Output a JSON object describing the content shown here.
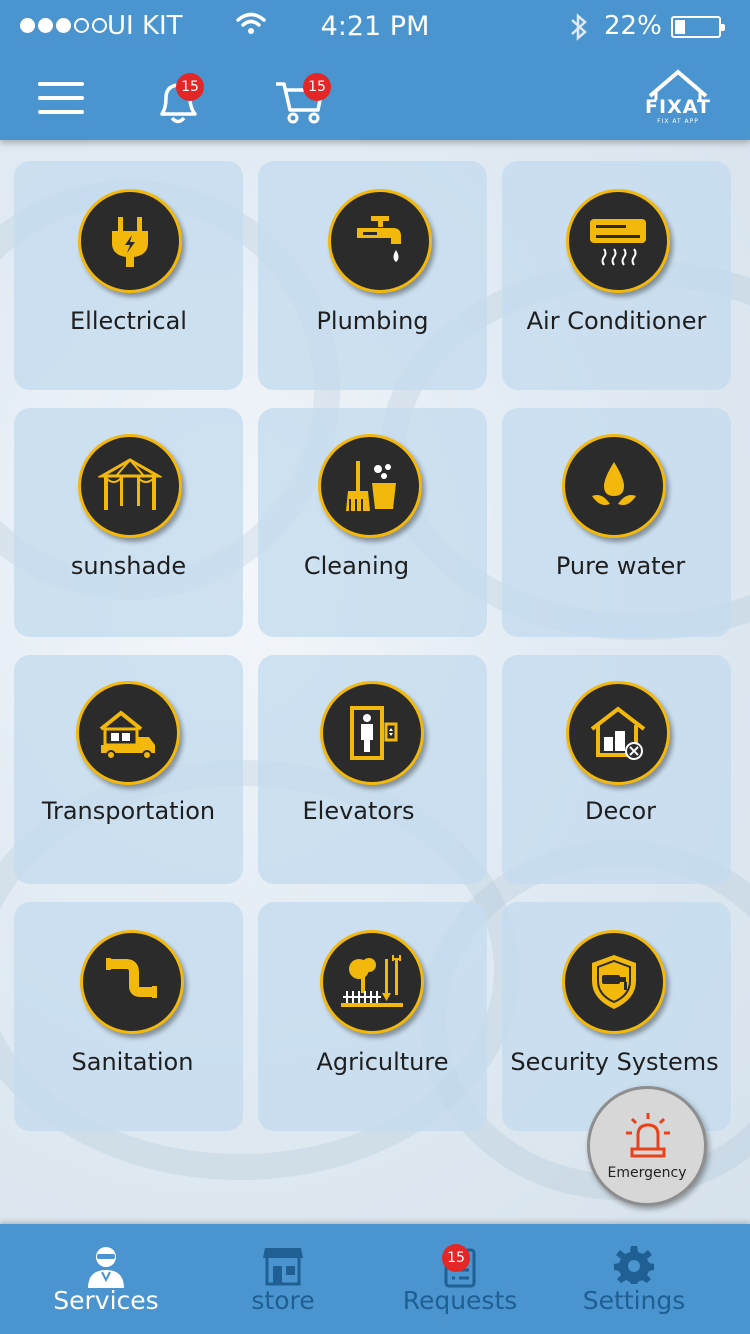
{
  "status_bar": {
    "carrier": "UI KIT",
    "time": "4:21 PM",
    "battery": "22%",
    "battery_level": 0.22,
    "signal_dots": 5,
    "signal_filled": 3
  },
  "header": {
    "notifications_badge": "15",
    "cart_badge": "15",
    "logo_text": "FIXAT",
    "logo_tagline": "FIX AT APP"
  },
  "categories": [
    {
      "label": "Ellectrical",
      "icon": "electric-plug-icon"
    },
    {
      "label": "Plumbing",
      "icon": "faucet-icon"
    },
    {
      "label": "Air Conditioner",
      "icon": "air-conditioner-icon"
    },
    {
      "label": "sunshade",
      "icon": "canopy-icon"
    },
    {
      "label": "Cleaning",
      "icon": "broom-bucket-icon"
    },
    {
      "label": "Pure water",
      "icon": "water-drop-icon"
    },
    {
      "label": "Transportation",
      "icon": "moving-truck-icon"
    },
    {
      "label": "Elevators",
      "icon": "elevator-icon"
    },
    {
      "label": "Decor",
      "icon": "home-decor-icon"
    },
    {
      "label": "Sanitation",
      "icon": "pipe-icon"
    },
    {
      "label": "Agriculture",
      "icon": "garden-tools-icon"
    },
    {
      "label": "Security Systems",
      "icon": "security-shield-icon"
    }
  ],
  "emergency": {
    "label": "Emergency",
    "icon": "siren-icon"
  },
  "bottom_nav": {
    "services": "Services",
    "store": "store",
    "requests": "Requests",
    "requests_badge": "15",
    "settings": "Settings"
  },
  "colors": {
    "header_blue": "#4a94cf",
    "icon_gold": "#f2b80c",
    "icon_dark": "#2b2b2b",
    "badge_red": "#e32626"
  }
}
